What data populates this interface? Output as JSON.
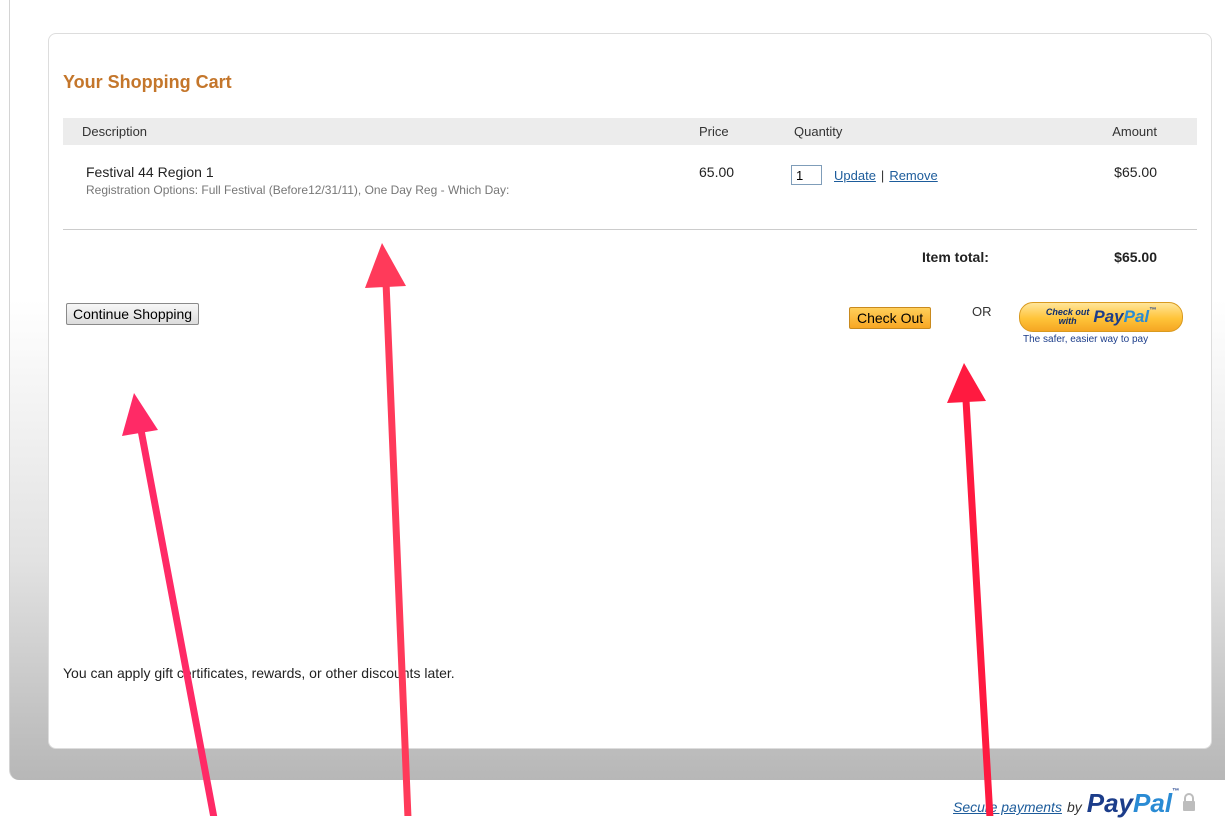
{
  "cart": {
    "title": "Your Shopping Cart",
    "columns": {
      "description": "Description",
      "price": "Price",
      "quantity": "Quantity",
      "amount": "Amount"
    },
    "items": [
      {
        "name": "Festival 44 Region 1",
        "options": "Registration Options: Full Festival (Before12/31/11), One Day Reg - Which Day:",
        "price": "65.00",
        "quantity": "1",
        "update_label": "Update",
        "separator": "|",
        "remove_label": "Remove",
        "amount": "$65.00"
      }
    ],
    "item_total_label": "Item total:",
    "item_total_value": "$65.00"
  },
  "actions": {
    "continue_label": "Continue Shopping",
    "checkout_label": "Check Out",
    "or_label": "OR",
    "paypal_button": {
      "small_top": "Check out",
      "small_bottom": "with",
      "logo_pay": "Pay",
      "logo_pal": "Pal",
      "tm": "™"
    },
    "paypal_tagline": "The safer, easier way to pay"
  },
  "discount_note": "You can apply gift certificates, rewards, or other discounts later.",
  "footer": {
    "secure_link": "Secure payments",
    "by": "by",
    "logo_pay": "Pay",
    "logo_pal": "Pal",
    "tm": "™"
  },
  "icons": {
    "lock": "lock-icon"
  },
  "colors": {
    "title": "#c4762b",
    "arrow": "#ff2a55",
    "link": "#1d5c9b",
    "paypal_gold": "#ffc439"
  }
}
